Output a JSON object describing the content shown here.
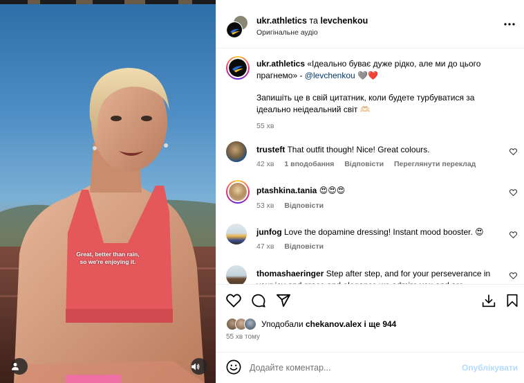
{
  "post": {
    "author": "ukr.athletics",
    "connector": "та",
    "coauthor": "levchenkou",
    "audio": "Оригінальне аудіо"
  },
  "video": {
    "subtitle_line1": "Great, better than rain,",
    "subtitle_line2": "so we're enjoying it."
  },
  "caption": {
    "username": "ukr.athletics",
    "text": "«Ідеально буває дуже рідко, але ми до цього прагнемо» - ",
    "mention": "@levchenkou",
    "text_tail": " 🩶❤️",
    "text2": "Запишіть це в свій цитатник, коли будете турбуватися за ідеально неідеальний світ 🫶🏻",
    "time": "55 хв"
  },
  "comments": [
    {
      "username": "trusteft",
      "text": "That outfit though! Nice! Great colours.",
      "time": "42 хв",
      "likes": "1 вподобання",
      "reply": "Відповісти",
      "translate": "Переглянути переклад"
    },
    {
      "username": "ptashkina.tania",
      "text": "😍😍😍",
      "time": "53 хв",
      "reply": "Відповісти"
    },
    {
      "username": "junfog",
      "text": "Love the dopamine dressing! Instant mood booster. 😍",
      "time": "47 хв",
      "reply": "Відповісти"
    },
    {
      "username": "thomashaeringer",
      "text": "Step after step, and for your perseverance in your joy and grace and elegance we admire you and are",
      "time": "",
      "reply": ""
    }
  ],
  "likes": {
    "prefix": "Уподобали",
    "user": "chekanov.alex",
    "suffix": " і ще ",
    "count": "944"
  },
  "posted": "55 хв тому",
  "composer": {
    "placeholder": "Додайте коментар...",
    "publish": "Опублікувати"
  },
  "colors": {
    "link": "#00376b",
    "meta": "#737373",
    "publish_disabled": "#b3dbff",
    "heart": "#ed4956"
  },
  "icons": [
    "more-icon",
    "heart-icon",
    "comment-icon",
    "share-icon",
    "save-icon",
    "bookmark-icon",
    "emoji-icon",
    "user-tag-icon",
    "sound-icon"
  ]
}
